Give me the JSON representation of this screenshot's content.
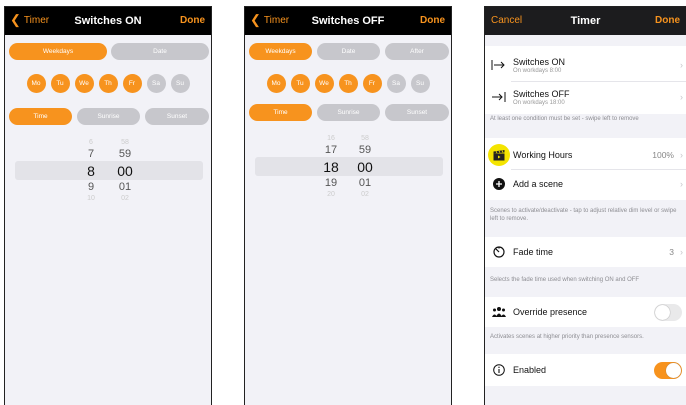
{
  "screen1": {
    "back_label": "Timer",
    "title": "Switches ON",
    "done_label": "Done",
    "segments1": [
      "Weekdays",
      "Date"
    ],
    "days": [
      "Mo",
      "Tu",
      "We",
      "Th",
      "Fr",
      "Sa",
      "Su"
    ],
    "segments2": [
      "Time",
      "Sunrise",
      "Sunset"
    ],
    "picker_hours": [
      "6",
      "7",
      "8",
      "9",
      "10"
    ],
    "picker_minutes": [
      "58",
      "59",
      "00",
      "01",
      "02"
    ]
  },
  "screen2": {
    "back_label": "Timer",
    "title": "Switches OFF",
    "done_label": "Done",
    "segments1": [
      "Weekdays",
      "Date",
      "After"
    ],
    "days": [
      "Mo",
      "Tu",
      "We",
      "Th",
      "Fr",
      "Sa",
      "Su"
    ],
    "segments2": [
      "Time",
      "Sunrise",
      "Sunset"
    ],
    "picker_hours": [
      "16",
      "17",
      "18",
      "19",
      "20"
    ],
    "picker_minutes": [
      "58",
      "59",
      "00",
      "01",
      "02"
    ]
  },
  "screen3": {
    "cancel_label": "Cancel",
    "title": "Timer",
    "done_label": "Done",
    "switch_on": {
      "label": "Switches ON",
      "sub": "On workdays  8:00"
    },
    "switch_off": {
      "label": "Switches OFF",
      "sub": "On workdays  18:00"
    },
    "condition_note": "At least one condition must be set - swipe left to remove",
    "working_hours": {
      "label": "Working Hours",
      "value": "100%"
    },
    "add_scene": "Add a scene",
    "scenes_note": "Scenes to activate/deactivate - tap to adjust relative dim level or swipe left to remove.",
    "fade_time": {
      "label": "Fade time",
      "value": "3"
    },
    "fade_note": "Selects the fade time used when switching ON and OFF",
    "override_presence": "Override presence",
    "override_note": "Activates scenes at higher priority than presence sensors.",
    "enabled": "Enabled"
  },
  "colors": {
    "accent": "#f7931e",
    "inactive": "#c7c7cc",
    "header": "#000000"
  },
  "icons": {
    "switch_on": "arrow-to-bar-right-icon",
    "switch_off": "arrow-to-bar-right-icon",
    "working_hours": "clapperboard-icon",
    "add_scene": "plus-circle-icon",
    "fade_time": "timer-icon",
    "override_presence": "people-icon",
    "enabled": "info-icon"
  }
}
